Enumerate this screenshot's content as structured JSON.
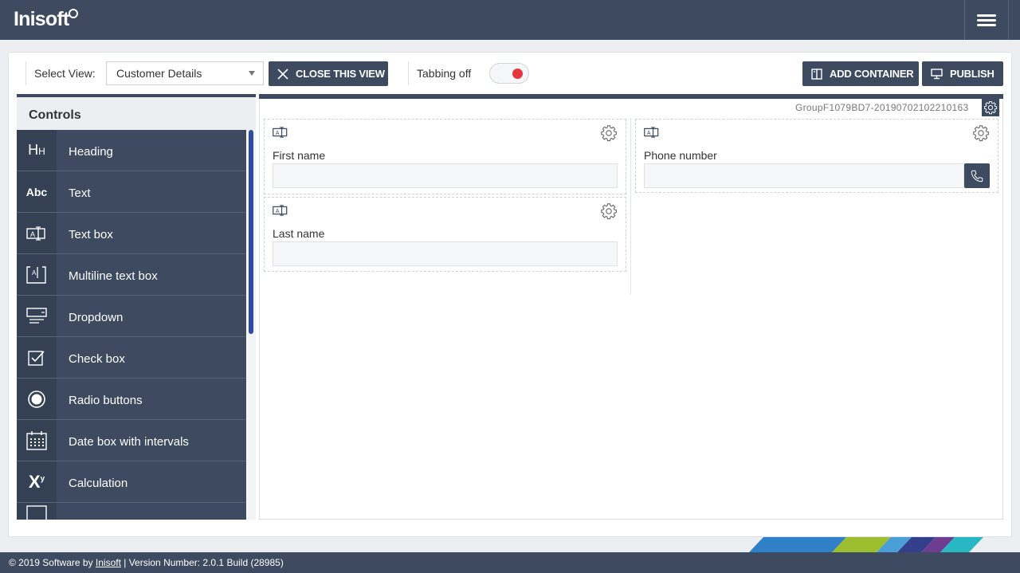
{
  "app": {
    "logo": "Inisoft"
  },
  "toolbar": {
    "select_view_label": "Select View:",
    "select_view_value": "Customer Details",
    "close_view_label": "CLOSE THIS VIEW",
    "tabbing_label": "Tabbing off",
    "tabbing_on": false,
    "add_container_label": "ADD CONTAINER",
    "publish_label": "PUBLISH"
  },
  "sidebar": {
    "title": "Controls",
    "items": [
      {
        "label": "Heading",
        "icon": "heading-icon"
      },
      {
        "label": "Text",
        "icon": "text-icon"
      },
      {
        "label": "Text box",
        "icon": "textbox-icon"
      },
      {
        "label": "Multiline text box",
        "icon": "multiline-textbox-icon"
      },
      {
        "label": "Dropdown",
        "icon": "dropdown-icon"
      },
      {
        "label": "Check box",
        "icon": "checkbox-icon"
      },
      {
        "label": "Radio buttons",
        "icon": "radio-icon"
      },
      {
        "label": "Date box with intervals",
        "icon": "calendar-icon"
      },
      {
        "label": "Calculation",
        "icon": "calculation-icon"
      }
    ]
  },
  "canvas": {
    "group_id": "GroupF1079BD7-20190702102210163",
    "fields": {
      "first_name": {
        "label": "First name",
        "value": ""
      },
      "last_name": {
        "label": "Last name",
        "value": ""
      },
      "phone_number": {
        "label": "Phone number",
        "value": ""
      }
    }
  },
  "footer": {
    "copyright": "© 2019 Software by ",
    "company_link": "Inisoft",
    "version": " | Version Number: 2.0.1 Build (28985)"
  },
  "colors": {
    "primary": "#3d4a5f",
    "toggle_off": "#e4373c",
    "scrollbar": "#2f4c9e"
  }
}
